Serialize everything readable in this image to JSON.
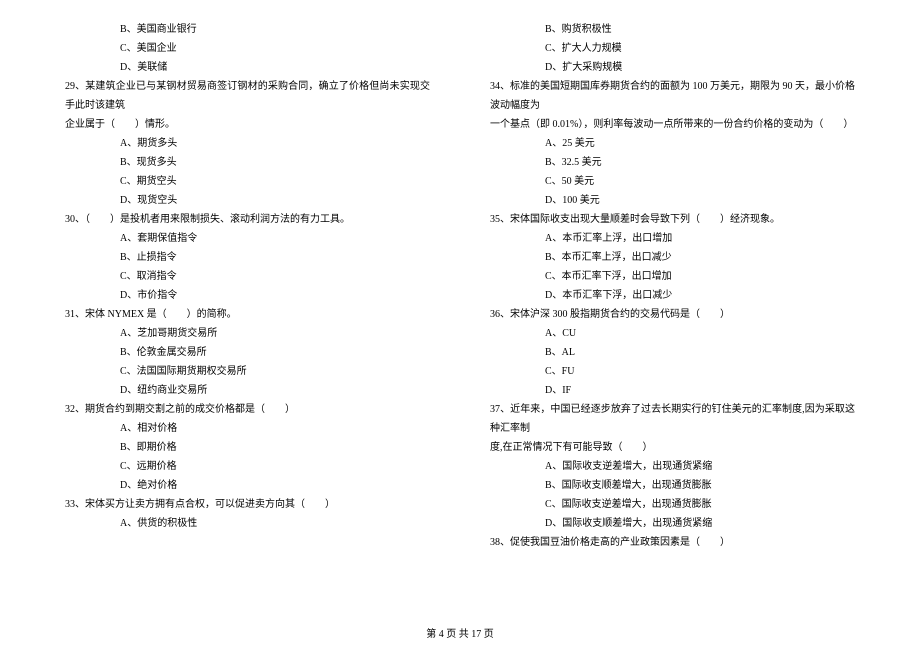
{
  "left_column": {
    "preq29_opts": [
      "B、美国商业银行",
      "C、美国企业",
      "D、美联储"
    ],
    "q29": {
      "stem1": "29、某建筑企业已与某钢材贸易商签订钢材的采购合同，确立了价格但尚未实现交手此时该建筑",
      "stem2": "企业属于（　　）情形。",
      "opts": [
        "A、期货多头",
        "B、现货多头",
        "C、期货空头",
        "D、现货空头"
      ]
    },
    "q30": {
      "stem": "30、（　　）是投机者用来限制损失、滚动利润方法的有力工具。",
      "opts": [
        "A、套期保值指令",
        "B、止损指令",
        "C、取消指令",
        "D、市价指令"
      ]
    },
    "q31": {
      "stem": "31、宋体 NYMEX 是（　　）的简称。",
      "opts": [
        "A、芝加哥期货交易所",
        "B、伦敦金属交易所",
        "C、法国国际期货期权交易所",
        "D、纽约商业交易所"
      ]
    },
    "q32": {
      "stem": "32、期货合约到期交割之前的成交价格都是（　　）",
      "opts": [
        "A、相对价格",
        "B、即期价格",
        "C、远期价格",
        "D、绝对价格"
      ]
    },
    "q33": {
      "stem": "33、宋体买方让卖方拥有点合权，可以促进卖方向其（　　）",
      "opts": [
        "A、供货的积极性"
      ]
    }
  },
  "right_column": {
    "preq34_opts": [
      "B、购货积极性",
      "C、扩大人力规模",
      "D、扩大采购规模"
    ],
    "q34": {
      "stem1": "34、标准的美国短期国库券期货合约的面额为 100 万美元，期限为 90 天，最小价格波动幅度为",
      "stem2": "一个基点（即 0.01%），则利率每波动一点所带来的一份合约价格的变动为（　　）",
      "opts": [
        "A、25 美元",
        "B、32.5 美元",
        "C、50 美元",
        "D、100 美元"
      ]
    },
    "q35": {
      "stem": "35、宋体国际收支出现大量顺差时会导致下列（　　）经济现象。",
      "opts": [
        "A、本币汇率上浮，出口增加",
        "B、本币汇率上浮，出口减少",
        "C、本币汇率下浮，出口增加",
        "D、本币汇率下浮，出口减少"
      ]
    },
    "q36": {
      "stem": "36、宋体沪深 300 股指期货合约的交易代码是（　　）",
      "opts": [
        "A、CU",
        "B、AL",
        "C、FU",
        "D、IF"
      ]
    },
    "q37": {
      "stem1": "37、近年来，中国已经逐步放弃了过去长期实行的钉住美元的汇率制度,因为采取这种汇率制",
      "stem2": "度,在正常情况下有可能导致（　　）",
      "opts": [
        "A、国际收支逆差增大，出现通货紧缩",
        "B、国际收支顺差增大，出现通货膨胀",
        "C、国际收支逆差增大，出现通货膨胀",
        "D、国际收支顺差增大，出现通货紧缩"
      ]
    },
    "q38": {
      "stem": "38、促使我国豆油价格走高的产业政策因素是（　　）"
    }
  },
  "footer": "第 4 页 共 17 页"
}
